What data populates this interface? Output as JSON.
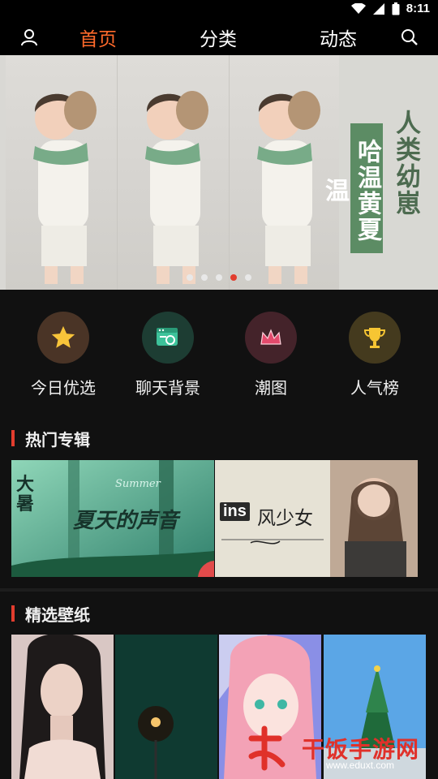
{
  "status_bar": {
    "time": "8:11"
  },
  "top_nav": {
    "tabs": [
      {
        "label": "首页",
        "active": true
      },
      {
        "label": "分类",
        "active": false
      },
      {
        "label": "动态",
        "active": false
      }
    ],
    "accent_color": "#ff6a2b",
    "icons": [
      "user-icon",
      "search-icon"
    ]
  },
  "banner": {
    "text_green": "哈温黄夏温",
    "text_dark": "人类幼崽",
    "slide_count": 5,
    "active_slide": 4
  },
  "categories": [
    {
      "label": "今日优选",
      "icon": "star-icon"
    },
    {
      "label": "聊天背景",
      "icon": "chat-background-icon"
    },
    {
      "label": "潮图",
      "icon": "crown-icon"
    },
    {
      "label": "人气榜",
      "icon": "trophy-icon"
    }
  ],
  "hot_albums": {
    "title": "热门专辑",
    "items": [
      {
        "caption": "夏天的声音",
        "corner_text": "大暑",
        "script_text": "Summer"
      },
      {
        "caption": "风少女",
        "badge": "ins"
      }
    ]
  },
  "featured_wallpapers": {
    "title": "精选壁纸"
  },
  "watermark": {
    "text": "干饭手游网",
    "url": "www.eduxt.com"
  }
}
